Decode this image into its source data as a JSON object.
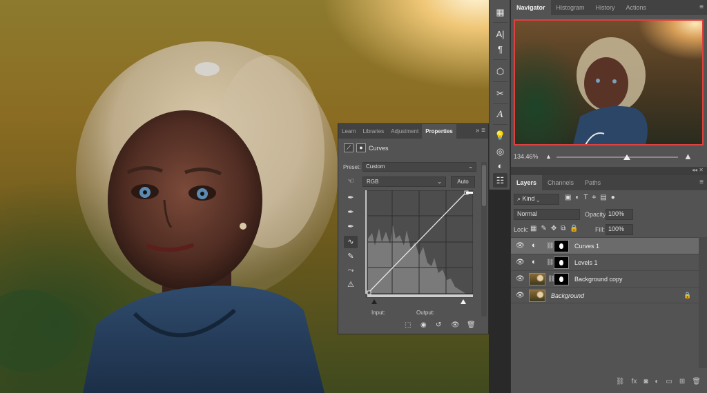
{
  "toolstrip": {
    "icons": [
      "grid-icon",
      "character-icon",
      "paragraph-icon",
      "3d-cube-icon",
      "tools-icon",
      "glyphs-icon",
      "lightbulb-icon",
      "libraries-icon",
      "adjustments-icon",
      "properties-icon"
    ],
    "glyph_character": "A|",
    "glyph_paragraph": "¶",
    "glyph_type": "𝐴"
  },
  "navigator": {
    "tabs": [
      "Navigator",
      "Histogram",
      "History",
      "Actions"
    ],
    "active_tab": "Navigator",
    "zoom": "134.46%",
    "zoom_level": 0.58,
    "frame_color": "#e04040"
  },
  "layers_panel": {
    "tabs": [
      "Layers",
      "Channels",
      "Paths"
    ],
    "active_tab": "Layers",
    "filter_kind": "Kind",
    "blend_mode": "Normal",
    "opacity_label": "Opacity:",
    "opacity": "100%",
    "lock_label": "Lock:",
    "fill_label": "Fill:",
    "fill": "100%",
    "layers": [
      {
        "name": "Curves 1",
        "type": "adjustment",
        "selected": true
      },
      {
        "name": "Levels 1",
        "type": "adjustment",
        "selected": false
      },
      {
        "name": "Background copy",
        "type": "image",
        "selected": false
      },
      {
        "name": "Background",
        "type": "background",
        "selected": false,
        "locked": true
      }
    ],
    "footer_icons": [
      "link-icon",
      "fx-icon",
      "mask-icon",
      "new-adjustment-icon",
      "folder-icon",
      "new-layer-icon",
      "trash-icon"
    ],
    "fx_label": "fx"
  },
  "properties_panel": {
    "tabs": [
      "Learn",
      "Libraries",
      "Adjustment",
      "Properties"
    ],
    "active_tab": "Properties",
    "title": "Curves",
    "preset_label": "Preset:",
    "preset": "Custom",
    "channel": "RGB",
    "auto_label": "Auto",
    "input_label": "Input:",
    "output_label": "Output:"
  }
}
